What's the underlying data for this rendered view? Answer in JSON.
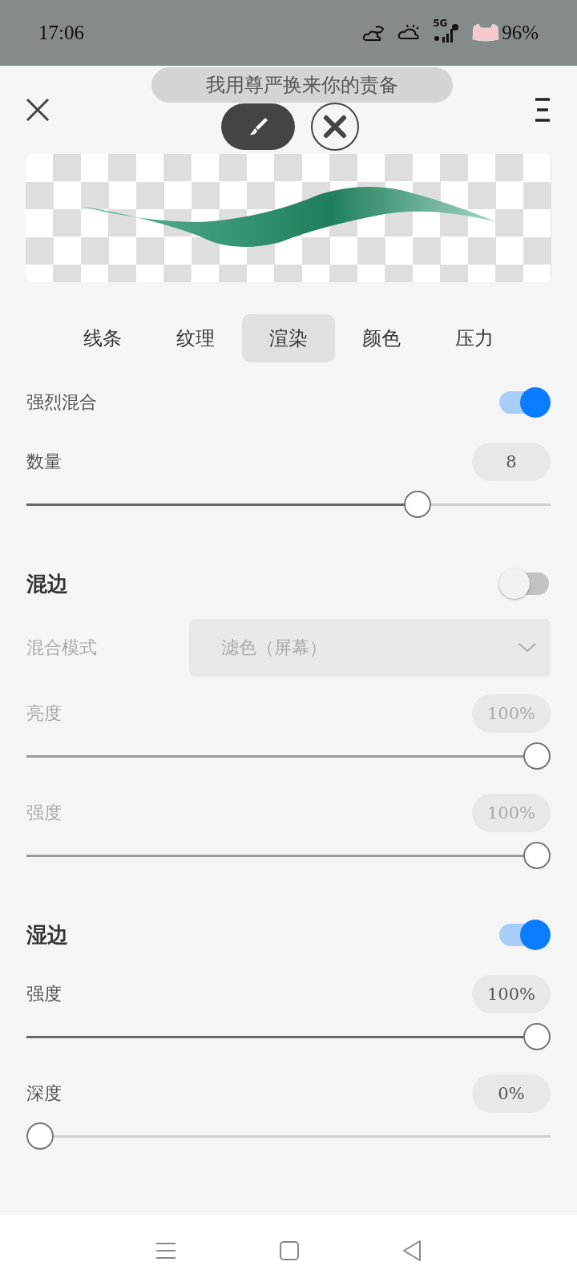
{
  "status_bar": {
    "time": "17:06",
    "network": "5G",
    "battery": "96%"
  },
  "toast": {
    "text": "我用尊严换来你的责备"
  },
  "tools": [
    {
      "kind": "brush",
      "selected": true
    },
    {
      "kind": "eraser",
      "selected": false
    }
  ],
  "tabs": [
    {
      "label": "线条",
      "selected": false
    },
    {
      "label": "纹理",
      "selected": false
    },
    {
      "label": "渲染",
      "selected": true
    },
    {
      "label": "颜色",
      "selected": false
    },
    {
      "label": "压力",
      "selected": false
    }
  ],
  "settings": [
    {
      "kind": "toggle",
      "label": "强烈混合",
      "on": true
    },
    {
      "kind": "slider",
      "label": "数量",
      "value": "8",
      "level": 0.76,
      "disabled": false
    },
    {
      "kind": "header",
      "label": "混边",
      "on": false
    },
    {
      "kind": "dropdown",
      "label": "混合模式",
      "value": "滤色（屏幕）",
      "disabled": true
    },
    {
      "kind": "slider",
      "label": "亮度",
      "value": "100%",
      "level": 1,
      "disabled": true
    },
    {
      "kind": "slider",
      "label": "强度",
      "value": "100%",
      "level": 1,
      "disabled": true
    },
    {
      "kind": "header",
      "label": "湿边",
      "on": true
    },
    {
      "kind": "slider",
      "label": "强度",
      "value": "100%",
      "level": 1,
      "disabled": false
    },
    {
      "kind": "slider",
      "label": "深度",
      "value": "0%",
      "level": 0,
      "disabled": false
    }
  ]
}
